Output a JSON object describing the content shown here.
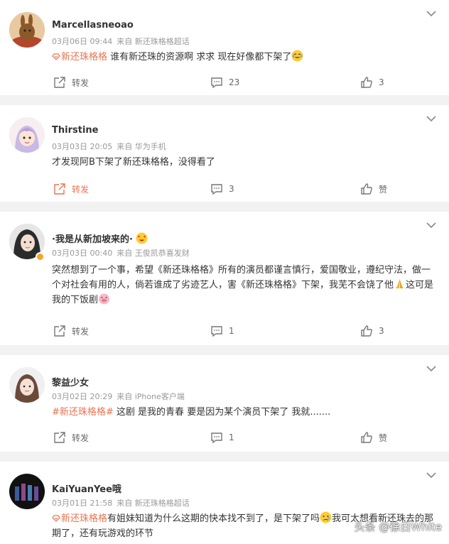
{
  "posts": [
    {
      "username": "Marcellasneoao",
      "date": "03月06日 09:44",
      "source": "来自 新还珠格格超话",
      "tag": "新还珠格格",
      "text": " 谁有新还珠的资源啊 求求 现在好像都下架了",
      "text_emoji": "cry-laugh-emoji",
      "repost_label": "转发",
      "comment_count": "23",
      "like_count": "3"
    },
    {
      "username": "Thirstine",
      "date": "03月03日 20:05",
      "source": "来自 华为手机",
      "text": "才发现阿B下架了新还珠格格，没得看了",
      "repost_label": "转发",
      "comment_count": "3",
      "like_count": "赞"
    },
    {
      "username": "·我是从新加坡来的·",
      "date": "03月03日 00:40",
      "source": "来自 王俊凯恭喜发财",
      "text_part1": "突然想到了一个事，希望《新还珠格格》所有的演员都谨言慎行，爱国敬业，遵纪守法，做一个对社会有用的人，倘若谁成了劣迹艺人，害《新还珠格格》下架，我芜不会饶了他",
      "text_part2": "这可是我的下饭剧",
      "repost_label": "转发",
      "comment_count": "1",
      "like_count": "3"
    },
    {
      "username": "黎益少女",
      "date": "03月02日 20:29",
      "source": "来自 iPhone客户端",
      "tag": "#新还珠格格#",
      "text": " 这剧 是我的青春 要是因为某个演员下架了 我就.......",
      "repost_label": "转发",
      "comment_count": "1",
      "like_count": "赞"
    },
    {
      "username": "KaiYuanYee哦",
      "date": "03月01日 21:58",
      "source": "来自 新还珠格格超话",
      "tag": "新还珠格格",
      "text_part1": "有姐妹知道为什么这期的快本找不到了，是下架了吗",
      "text_part2": "我可太想看新还珠去的那期了，还有玩游戏的环节"
    }
  ],
  "watermark": "头条 @徐白White",
  "colors": {
    "accent": "#eb7350",
    "meta": "#999999",
    "text": "#333333",
    "bg": "#f2f2f2"
  }
}
